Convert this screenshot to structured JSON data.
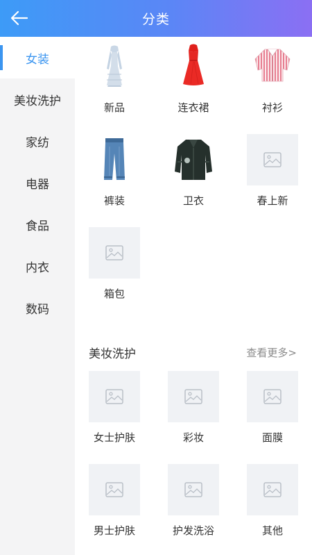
{
  "header": {
    "title": "分类",
    "back_icon": "arrow-left-icon"
  },
  "sidebar": {
    "items": [
      {
        "label": "女装",
        "active": true
      },
      {
        "label": "美妆洗护"
      },
      {
        "label": "家纺"
      },
      {
        "label": "电器"
      },
      {
        "label": "食品"
      },
      {
        "label": "内衣"
      },
      {
        "label": "数码"
      }
    ]
  },
  "women": {
    "items": [
      {
        "label": "新品",
        "icon": "dress-photo"
      },
      {
        "label": "连衣裙",
        "icon": "red-dress-photo"
      },
      {
        "label": "衬衫",
        "icon": "striped-shirt-photo"
      },
      {
        "label": "裤装",
        "icon": "jeans-photo"
      },
      {
        "label": "卫衣",
        "icon": "cardigan-photo"
      },
      {
        "label": "春上新",
        "icon": "image-placeholder-icon"
      },
      {
        "label": "箱包",
        "icon": "image-placeholder-icon"
      }
    ]
  },
  "beauty": {
    "title": "美妆洗护",
    "more": "查看更多>",
    "items": [
      {
        "label": "女士护肤"
      },
      {
        "label": "彩妆"
      },
      {
        "label": "面膜"
      },
      {
        "label": "男士护肤"
      },
      {
        "label": "护发洗浴"
      },
      {
        "label": "其他"
      }
    ]
  },
  "colors": {
    "accent": "#3b95f0",
    "header_start": "#3d9bf7",
    "header_end": "#8b6ff3",
    "placeholder_bg": "#f0f2f5"
  }
}
